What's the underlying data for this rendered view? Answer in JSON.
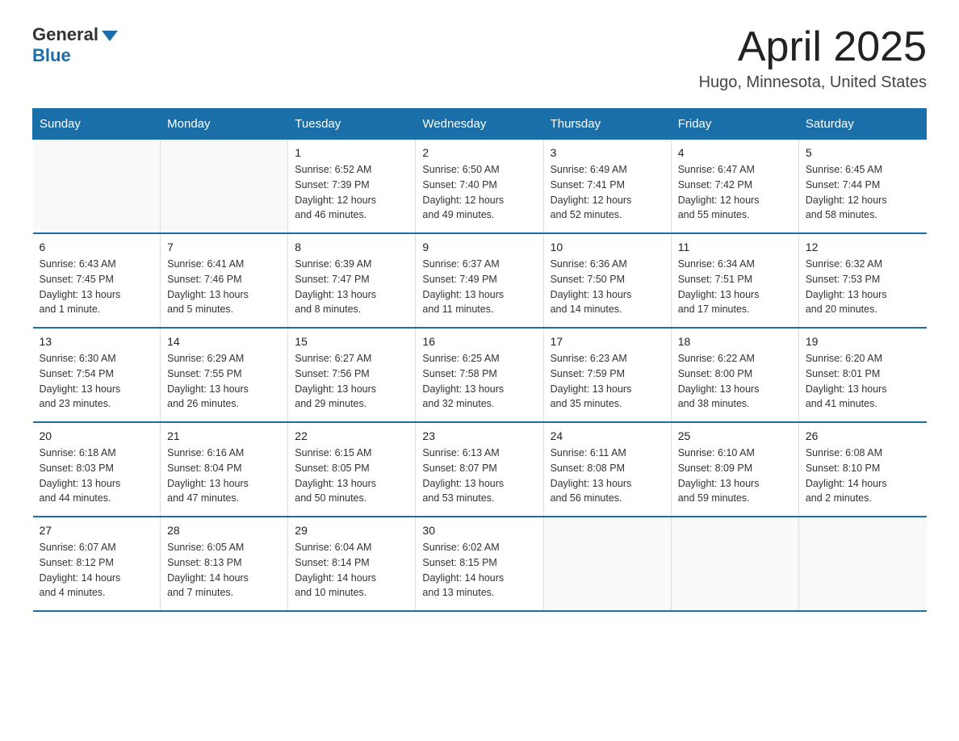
{
  "logo": {
    "general": "General",
    "blue": "Blue"
  },
  "title": "April 2025",
  "location": "Hugo, Minnesota, United States",
  "days_of_week": [
    "Sunday",
    "Monday",
    "Tuesday",
    "Wednesday",
    "Thursday",
    "Friday",
    "Saturday"
  ],
  "weeks": [
    [
      {
        "day": "",
        "info": ""
      },
      {
        "day": "",
        "info": ""
      },
      {
        "day": "1",
        "info": "Sunrise: 6:52 AM\nSunset: 7:39 PM\nDaylight: 12 hours\nand 46 minutes."
      },
      {
        "day": "2",
        "info": "Sunrise: 6:50 AM\nSunset: 7:40 PM\nDaylight: 12 hours\nand 49 minutes."
      },
      {
        "day": "3",
        "info": "Sunrise: 6:49 AM\nSunset: 7:41 PM\nDaylight: 12 hours\nand 52 minutes."
      },
      {
        "day": "4",
        "info": "Sunrise: 6:47 AM\nSunset: 7:42 PM\nDaylight: 12 hours\nand 55 minutes."
      },
      {
        "day": "5",
        "info": "Sunrise: 6:45 AM\nSunset: 7:44 PM\nDaylight: 12 hours\nand 58 minutes."
      }
    ],
    [
      {
        "day": "6",
        "info": "Sunrise: 6:43 AM\nSunset: 7:45 PM\nDaylight: 13 hours\nand 1 minute."
      },
      {
        "day": "7",
        "info": "Sunrise: 6:41 AM\nSunset: 7:46 PM\nDaylight: 13 hours\nand 5 minutes."
      },
      {
        "day": "8",
        "info": "Sunrise: 6:39 AM\nSunset: 7:47 PM\nDaylight: 13 hours\nand 8 minutes."
      },
      {
        "day": "9",
        "info": "Sunrise: 6:37 AM\nSunset: 7:49 PM\nDaylight: 13 hours\nand 11 minutes."
      },
      {
        "day": "10",
        "info": "Sunrise: 6:36 AM\nSunset: 7:50 PM\nDaylight: 13 hours\nand 14 minutes."
      },
      {
        "day": "11",
        "info": "Sunrise: 6:34 AM\nSunset: 7:51 PM\nDaylight: 13 hours\nand 17 minutes."
      },
      {
        "day": "12",
        "info": "Sunrise: 6:32 AM\nSunset: 7:53 PM\nDaylight: 13 hours\nand 20 minutes."
      }
    ],
    [
      {
        "day": "13",
        "info": "Sunrise: 6:30 AM\nSunset: 7:54 PM\nDaylight: 13 hours\nand 23 minutes."
      },
      {
        "day": "14",
        "info": "Sunrise: 6:29 AM\nSunset: 7:55 PM\nDaylight: 13 hours\nand 26 minutes."
      },
      {
        "day": "15",
        "info": "Sunrise: 6:27 AM\nSunset: 7:56 PM\nDaylight: 13 hours\nand 29 minutes."
      },
      {
        "day": "16",
        "info": "Sunrise: 6:25 AM\nSunset: 7:58 PM\nDaylight: 13 hours\nand 32 minutes."
      },
      {
        "day": "17",
        "info": "Sunrise: 6:23 AM\nSunset: 7:59 PM\nDaylight: 13 hours\nand 35 minutes."
      },
      {
        "day": "18",
        "info": "Sunrise: 6:22 AM\nSunset: 8:00 PM\nDaylight: 13 hours\nand 38 minutes."
      },
      {
        "day": "19",
        "info": "Sunrise: 6:20 AM\nSunset: 8:01 PM\nDaylight: 13 hours\nand 41 minutes."
      }
    ],
    [
      {
        "day": "20",
        "info": "Sunrise: 6:18 AM\nSunset: 8:03 PM\nDaylight: 13 hours\nand 44 minutes."
      },
      {
        "day": "21",
        "info": "Sunrise: 6:16 AM\nSunset: 8:04 PM\nDaylight: 13 hours\nand 47 minutes."
      },
      {
        "day": "22",
        "info": "Sunrise: 6:15 AM\nSunset: 8:05 PM\nDaylight: 13 hours\nand 50 minutes."
      },
      {
        "day": "23",
        "info": "Sunrise: 6:13 AM\nSunset: 8:07 PM\nDaylight: 13 hours\nand 53 minutes."
      },
      {
        "day": "24",
        "info": "Sunrise: 6:11 AM\nSunset: 8:08 PM\nDaylight: 13 hours\nand 56 minutes."
      },
      {
        "day": "25",
        "info": "Sunrise: 6:10 AM\nSunset: 8:09 PM\nDaylight: 13 hours\nand 59 minutes."
      },
      {
        "day": "26",
        "info": "Sunrise: 6:08 AM\nSunset: 8:10 PM\nDaylight: 14 hours\nand 2 minutes."
      }
    ],
    [
      {
        "day": "27",
        "info": "Sunrise: 6:07 AM\nSunset: 8:12 PM\nDaylight: 14 hours\nand 4 minutes."
      },
      {
        "day": "28",
        "info": "Sunrise: 6:05 AM\nSunset: 8:13 PM\nDaylight: 14 hours\nand 7 minutes."
      },
      {
        "day": "29",
        "info": "Sunrise: 6:04 AM\nSunset: 8:14 PM\nDaylight: 14 hours\nand 10 minutes."
      },
      {
        "day": "30",
        "info": "Sunrise: 6:02 AM\nSunset: 8:15 PM\nDaylight: 14 hours\nand 13 minutes."
      },
      {
        "day": "",
        "info": ""
      },
      {
        "day": "",
        "info": ""
      },
      {
        "day": "",
        "info": ""
      }
    ]
  ]
}
